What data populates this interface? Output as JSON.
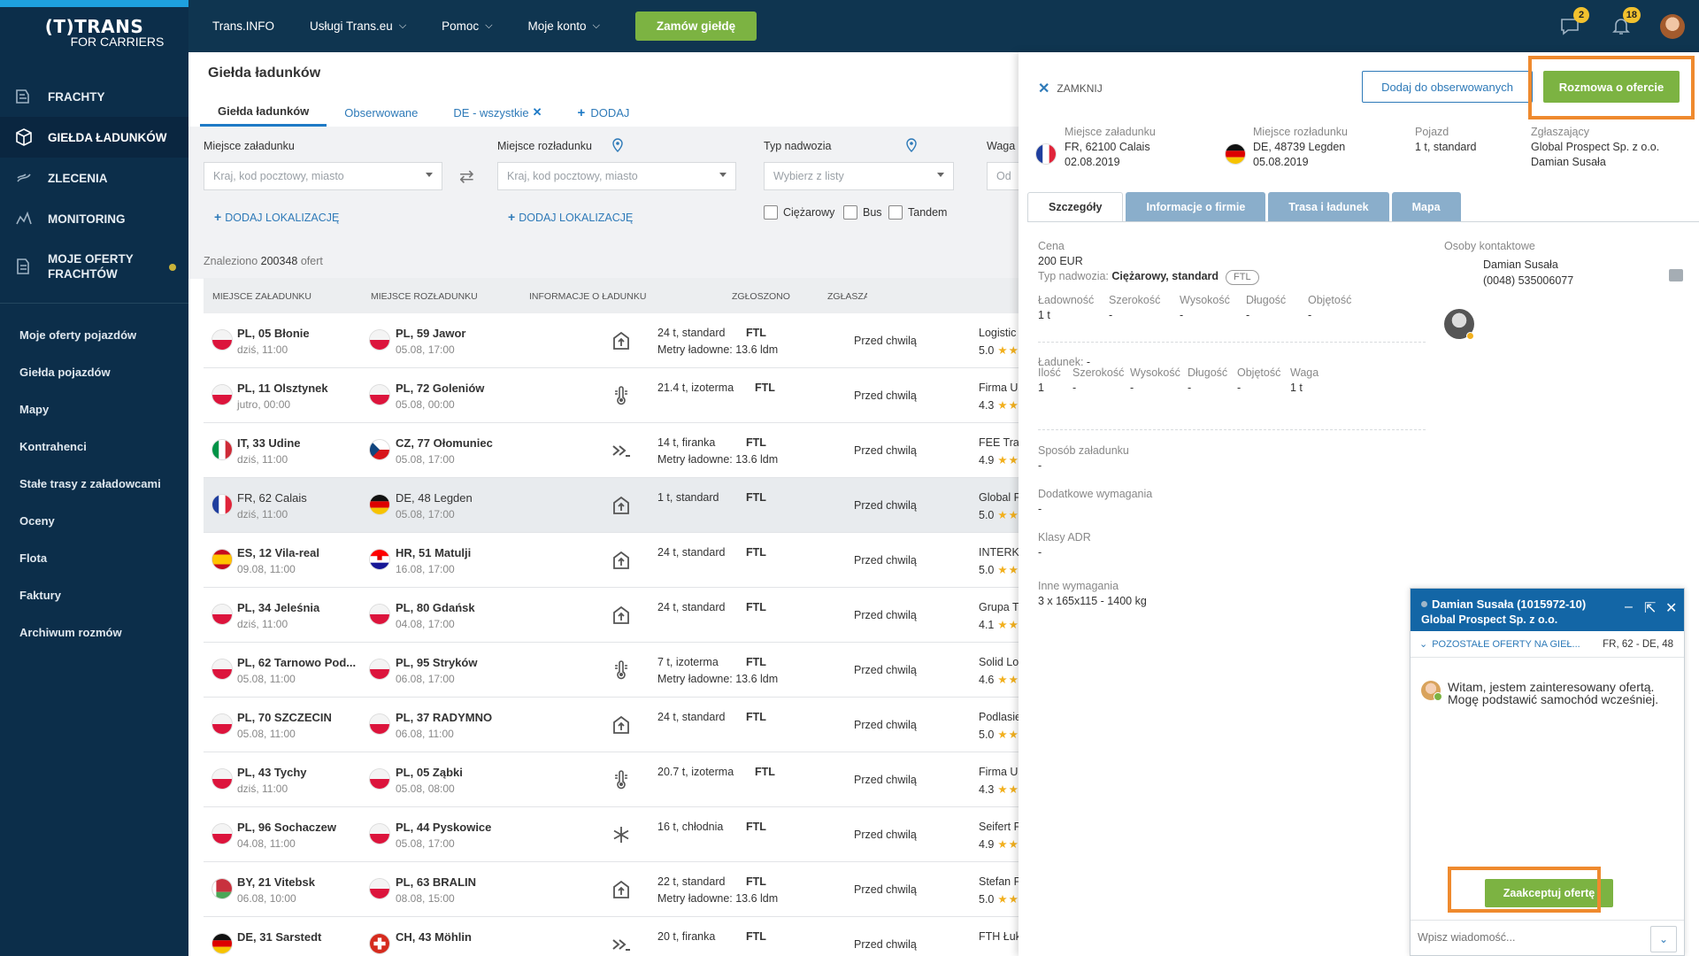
{
  "brand": {
    "line1": "(T)TRANS",
    "line2": "FOR CARRIERS"
  },
  "sidebar": {
    "main": [
      {
        "label": "FRACHTY",
        "icon": "freight-icon"
      },
      {
        "label": "GIEŁDA ŁADUNKÓW",
        "icon": "box-icon",
        "active": true
      },
      {
        "label": "ZLECENIA",
        "icon": "orders-icon"
      },
      {
        "label": "MONITORING",
        "icon": "monitoring-icon"
      },
      {
        "label_line1": "MOJE OFERTY",
        "label_line2": "FRACHTÓW",
        "icon": "my-offers-icon"
      }
    ],
    "sub": [
      "Moje oferty pojazdów",
      "Giełda pojazdów",
      "Mapy",
      "Kontrahenci",
      "Stałe trasy z załadowcami",
      "Oceny",
      "Flota",
      "Faktury",
      "Archiwum rozmów"
    ]
  },
  "topbar": {
    "links": [
      "Trans.INFO",
      "Usługi Trans.eu",
      "Pomoc",
      "Moje konto"
    ],
    "order_button": "Zamów giełdę",
    "chat_badge": "2",
    "notif_badge": "18"
  },
  "main": {
    "title": "Giełda ładunków",
    "tabs": [
      "Giełda ładunków",
      "Obserwowane",
      "DE - wszystkie",
      "DODAJ"
    ],
    "filters": {
      "load_label": "Miejsce załadunku",
      "load_placeholder": "Kraj, kod pocztowy, miasto",
      "unload_label": "Miejsce rozładunku",
      "unload_placeholder": "Kraj, kod pocztowy, miasto",
      "add_location": "DODAJ LOKALIZACJĘ",
      "body_label": "Typ nadwozia",
      "body_placeholder": "Wybierz z listy",
      "weight_label": "Waga",
      "weight_placeholder": "Od",
      "checks": [
        "Ciężarowy",
        "Bus",
        "Tandem"
      ]
    },
    "found_prefix": "Znaleziono",
    "found_count": "200348",
    "found_suffix": "ofert",
    "columns": [
      "MIEJSCE ZAŁADUNKU",
      "MIEJSCE ROZŁADUNKU",
      "INFORMACJE O ŁADUNKU",
      "ZGŁOSZONO",
      "ZGŁASZAJĄ"
    ]
  },
  "rows": [
    {
      "from_flag": "pl",
      "from": "PL, 05 Błonie",
      "from_date": "dziś, 11:00",
      "to_flag": "pl",
      "to": "PL, 59 Jawor",
      "to_date": "05.08, 17:00",
      "icon": "upload-icon",
      "cargo": "24 t, standard",
      "ftl": "FTL",
      "ldm": "Metry ładowne: 13.6 ldm",
      "when": "Przed chwilą",
      "company": "Logistic N",
      "rating": "5.0"
    },
    {
      "from_flag": "pl",
      "from": "PL, 11 Olsztynek",
      "from_date": "jutro, 00:00",
      "to_flag": "pl",
      "to": "PL, 72 Goleniów",
      "to_date": "05.08, 00:00",
      "icon": "thermometer-icon",
      "cargo": "21.4 t, izoterma",
      "ftl": "FTL",
      "ldm": "",
      "when": "Przed chwilą",
      "company": "Firma Usł",
      "rating": "4.3"
    },
    {
      "from_flag": "it",
      "from": "IT, 33 Udine",
      "from_date": "dziś, 11:00",
      "to_flag": "cz",
      "to": "CZ, 77 Ołomuniec",
      "to_date": "05.08, 17:00",
      "icon": "side-load-icon",
      "cargo": "14 t, firanka",
      "ftl": "FTL",
      "ldm": "Metry ładowne: 13.6 ldm",
      "when": "Przed chwilą",
      "company": "FEE Trans",
      "rating": "4.9"
    },
    {
      "from_flag": "fr",
      "from": "FR, 62 Calais",
      "from_date": "dziś, 11:00",
      "to_flag": "de",
      "to": "DE, 48 Legden",
      "to_date": "05.08, 17:00",
      "icon": "upload-icon",
      "cargo": "1 t, standard",
      "ftl": "FTL",
      "ldm": "",
      "when": "Przed chwilą",
      "company": "Global Pro",
      "rating": "5.0",
      "selected": true
    },
    {
      "from_flag": "es",
      "from": "ES, 12 Vila-real",
      "from_date": "09.08, 11:00",
      "to_flag": "hr",
      "to": "HR, 51 Matulji",
      "to_date": "16.08, 17:00",
      "icon": "upload-icon",
      "cargo": "24 t, standard",
      "ftl": "FTL",
      "ldm": "",
      "when": "Przed chwilą",
      "company": "INTERKOI",
      "rating": "5.0"
    },
    {
      "from_flag": "pl",
      "from": "PL, 34 Jeleśnia",
      "from_date": "dziś, 11:00",
      "to_flag": "pl",
      "to": "PL, 80 Gdańsk",
      "to_date": "04.08, 17:00",
      "icon": "upload-icon",
      "cargo": "24 t, standard",
      "ftl": "FTL",
      "ldm": "",
      "when": "Przed chwilą",
      "company": "Grupa Tra",
      "rating": "4.1"
    },
    {
      "from_flag": "pl",
      "from": "PL, 62 Tarnowo Pod...",
      "from_date": "05.08, 11:00",
      "to_flag": "pl",
      "to": "PL, 95 Stryków",
      "to_date": "06.08, 17:00",
      "icon": "thermometer-icon",
      "cargo": "7 t, izoterma",
      "ftl": "FTL",
      "ldm": "Metry ładowne: 13.6 ldm",
      "when": "Przed chwilą",
      "company": "Solid Logi",
      "rating": "4.6"
    },
    {
      "from_flag": "pl",
      "from": "PL, 70 SZCZECIN",
      "from_date": "05.08, 11:00",
      "to_flag": "pl",
      "to": "PL, 37 RADYMNO",
      "to_date": "06.08, 11:00",
      "icon": "upload-icon",
      "cargo": "24 t, standard",
      "ftl": "FTL",
      "ldm": "",
      "when": "Przed chwilą",
      "company": "Podlasie s",
      "rating": "5.0"
    },
    {
      "from_flag": "pl",
      "from": "PL, 43 Tychy",
      "from_date": "dziś, 11:00",
      "to_flag": "pl",
      "to": "PL, 05 Ząbki",
      "to_date": "05.08, 08:00",
      "icon": "thermometer-icon",
      "cargo": "20.7 t, izoterma",
      "ftl": "FTL",
      "ldm": "",
      "when": "Przed chwilą",
      "company": "Firma Usł",
      "rating": "4.3"
    },
    {
      "from_flag": "pl",
      "from": "PL, 96 Sochaczew",
      "from_date": "04.08, 11:00",
      "to_flag": "pl",
      "to": "PL, 44 Pyskowice",
      "to_date": "05.08, 17:00",
      "icon": "snowflake-icon",
      "cargo": "16 t, chłodnia",
      "ftl": "FTL",
      "ldm": "",
      "when": "Przed chwilą",
      "company": "Seifert Po",
      "rating": "4.9"
    },
    {
      "from_flag": "by",
      "from": "BY, 21 Vitebsk",
      "from_date": "06.08, 10:00",
      "to_flag": "pl",
      "to": "PL, 63 BRALIN",
      "to_date": "08.08, 15:00",
      "icon": "upload-icon",
      "cargo": "22 t, standard",
      "ftl": "FTL",
      "ldm": "Metry ładowne: 13.6 ldm",
      "when": "Przed chwilą",
      "company": "Stefan Pie",
      "rating": "5.0"
    },
    {
      "from_flag": "de",
      "from": "DE, 31 Sarstedt",
      "from_date": "",
      "to_flag": "ch",
      "to": "CH, 43 Möhlin",
      "to_date": "",
      "icon": "side-load-icon",
      "cargo": "20 t, firanka",
      "ftl": "FTL",
      "ldm": "",
      "when": "Przed chwilą",
      "company": "FTH Łukm",
      "rating": ""
    }
  ],
  "detail": {
    "close": "ZAMKNIJ",
    "watch": "Dodaj do obserwowanych",
    "chat_offer": "Rozmowa o ofercie",
    "load_label": "Miejsce załadunku",
    "load_place": "FR, 62100 Calais",
    "load_date": "02.08.2019",
    "unload_label": "Miejsce rozładunku",
    "unload_place": "DE, 48739 Legden",
    "unload_date": "05.08.2019",
    "vehicle_label": "Pojazd",
    "vehicle": "1 t, standard",
    "reporter_label": "Zgłaszający",
    "reporter_company": "Global Prospect Sp. z o.o.",
    "reporter_name": "Damian Susała",
    "tabs": [
      "Szczegóły",
      "Informacje o firmie",
      "Trasa i ładunek",
      "Mapa"
    ],
    "price_label": "Cena",
    "price": "200 EUR",
    "body_label": "Typ nadwozia:",
    "body": "Ciężarowy, standard",
    "ftl": "FTL",
    "dims1": [
      {
        "label": "Ładowność",
        "value": "1 t"
      },
      {
        "label": "Szerokość",
        "value": "-"
      },
      {
        "label": "Wysokość",
        "value": "-"
      },
      {
        "label": "Długość",
        "value": "-"
      },
      {
        "label": "Objętość",
        "value": "-"
      }
    ],
    "cargo_label": "Ładunek:",
    "cargo_value": "-",
    "dims2": [
      {
        "label": "Ilość",
        "value": "1"
      },
      {
        "label": "Szerokość",
        "value": "-"
      },
      {
        "label": "Wysokość",
        "value": "-"
      },
      {
        "label": "Długość",
        "value": "-"
      },
      {
        "label": "Objętość",
        "value": "-"
      },
      {
        "label": "Waga",
        "value": "1 t"
      }
    ],
    "loading_method_label": "Sposób załadunku",
    "loading_method": "-",
    "extra_req_label": "Dodatkowe wymagania",
    "extra_req": "-",
    "adr_label": "Klasy ADR",
    "adr": "-",
    "other_req_label": "Inne wymagania",
    "other_req": "3 x 165x115 - 1400 kg",
    "contacts_label": "Osoby kontaktowe",
    "contact_name": "Damian Susała",
    "contact_phone": "(0048) 535006077"
  },
  "chat": {
    "name": "Damian Susała (1015972-10)",
    "company": "Global Prospect Sp. z o.o.",
    "other_offers": "POZOSTAŁE OFERTY NA GIEŁ...",
    "route": "FR, 62 - DE, 48",
    "message": "Witam, jestem zainteresowany ofertą. Mogę podstawić samochód wcześniej.",
    "accept": "Zaakceptuj ofertę",
    "input_placeholder": "Wpisz wiadomość..."
  },
  "colors": {
    "accent_green": "#7cb342",
    "highlight_orange": "#ef8a2e",
    "sidebar": "#0c2e4a",
    "link_blue": "#2e7ab8"
  }
}
